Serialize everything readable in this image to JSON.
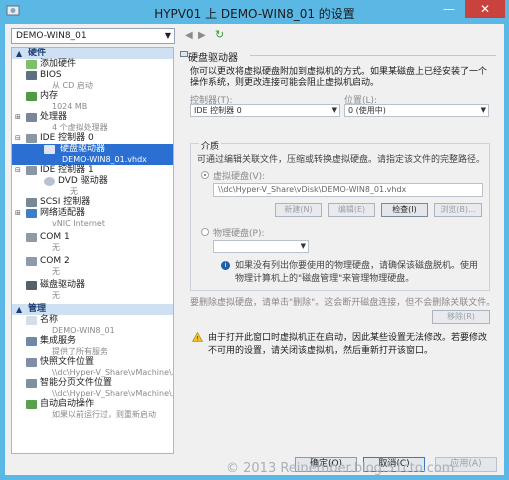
{
  "window": {
    "title": "HYPV01 上 DEMO-WIN8_01 的设置",
    "minimize_glyph": "—",
    "close_glyph": "✕"
  },
  "toolbar": {
    "vm_selected": "DEMO-WIN8_01",
    "back_glyph": "◀",
    "forward_glyph": "▶",
    "refresh_glyph": "↻"
  },
  "tree": {
    "hardware_section": "硬件",
    "management_section": "管理",
    "hardware": [
      {
        "label": "添加硬件",
        "sub": "",
        "icon": "add-hardware-icon"
      },
      {
        "label": "BIOS",
        "sub": "从 CD 启动",
        "icon": "bios-icon"
      },
      {
        "label": "内存",
        "sub": "1024 MB",
        "icon": "memory-icon"
      },
      {
        "label": "处理器",
        "sub": "4 个虚拟处理器",
        "icon": "processor-icon"
      },
      {
        "label": "IDE 控制器 0",
        "sub": "",
        "icon": "ide-controller-icon"
      },
      {
        "label": "硬盘驱动器",
        "sub": "DEMO-WIN8_01.vhdx",
        "icon": "hard-drive-icon"
      },
      {
        "label": "IDE 控制器 1",
        "sub": "",
        "icon": "ide-controller-icon"
      },
      {
        "label": "DVD 驱动器",
        "sub": "无",
        "icon": "dvd-drive-icon"
      },
      {
        "label": "SCSI 控制器",
        "sub": "",
        "icon": "scsi-controller-icon"
      },
      {
        "label": "网络适配器",
        "sub": "vNIC Internet",
        "icon": "network-adapter-icon"
      },
      {
        "label": "COM 1",
        "sub": "无",
        "icon": "com-port-icon"
      },
      {
        "label": "COM 2",
        "sub": "无",
        "icon": "com-port-icon"
      },
      {
        "label": "磁盘驱动器",
        "sub": "无",
        "icon": "floppy-drive-icon"
      }
    ],
    "management": [
      {
        "label": "名称",
        "sub": "DEMO-WIN8_01",
        "icon": "name-icon"
      },
      {
        "label": "集成服务",
        "sub": "提供了所有服务",
        "icon": "integration-services-icon"
      },
      {
        "label": "快照文件位置",
        "sub": "\\\\dc\\Hyper-V_Share\\vMachine\\...",
        "icon": "snapshot-location-icon"
      },
      {
        "label": "智能分页文件位置",
        "sub": "\\\\dc\\Hyper-V_Share\\vMachine\\...",
        "icon": "smart-paging-icon"
      },
      {
        "label": "自动启动操作",
        "sub": "如果以前运行过，则重新启动",
        "icon": "auto-start-icon"
      }
    ]
  },
  "panel": {
    "heading": "硬盘驱动器",
    "description": "你可以更改将虚拟硬盘附加到虚拟机的方式。如果某磁盘上已经安装了一个操作系统，则更改连接可能会阻止虚拟机启动。",
    "controller_label": "控制器(T):",
    "controller_value": "IDE 控制器 0",
    "location_label": "位置(L):",
    "location_value": "0 (使用中)",
    "media_title": "介质",
    "media_desc": "可通过编辑关联文件，压缩或转换虚拟硬盘。请指定该文件的完整路径。",
    "vhd_label": "虚拟硬盘(V):",
    "vhd_path": "\\\\dc\\Hyper-V_Share\\vDisk\\DEMO-WIN8_01.vhdx",
    "btn_new": "新建(N)",
    "btn_edit": "编辑(E)",
    "btn_inspect": "检查(I)",
    "btn_browse": "浏览(B)...",
    "physical_label": "物理硬盘(P):",
    "physical_value": "",
    "physical_note": "如果没有列出你要使用的物理硬盘，请确保该磁盘脱机。使用物理计算机上的\"磁盘管理\"来管理物理硬盘。",
    "remove_note": "要删除虚拟硬盘，请单击\"删除\"。这会断开磁盘连接，但不会删除关联文件。",
    "btn_remove": "移除(R)",
    "warning_text": "由于打开此窗口时虚拟机正在启动，因此某些设置无法修改。若要修改不可用的设置，请关闭该虚拟机，然后重新打开该窗口。"
  },
  "footer": {
    "ok": "确定(O)",
    "cancel": "取消(C)",
    "apply": "应用(A)"
  },
  "watermark": "© 2013 Reinember.blog.51cto.com",
  "colors": {
    "titlebar": "#5bb8e4",
    "close": "#c9423e",
    "selection": "#2a6fd1",
    "section_header": "#cfe0f3"
  }
}
